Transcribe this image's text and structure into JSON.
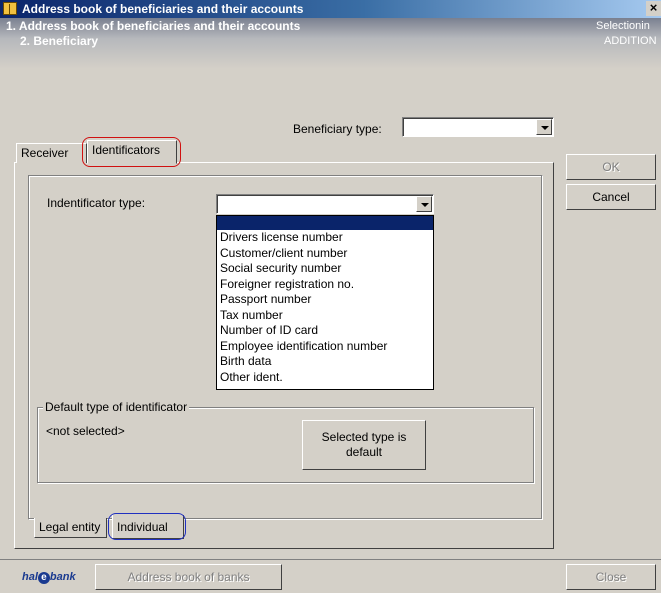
{
  "window": {
    "title": "Address book of beneficiaries and their accounts",
    "close_glyph": "×"
  },
  "header": {
    "line1": "1. Address book of beneficiaries and their accounts",
    "line2": "2. Beneficiary",
    "right1": "Selectionin",
    "right2": "ADDITION"
  },
  "beneficiary_type": {
    "label": "Beneficiary type:",
    "value": ""
  },
  "top_tabs": [
    {
      "label": "Receiver",
      "active": false
    },
    {
      "label": "Identificators",
      "active": true
    }
  ],
  "buttons": {
    "ok": "OK",
    "cancel": "Cancel",
    "selected_default": "Selected type is default"
  },
  "identificator_type": {
    "label": "Indentificator type:",
    "value": "",
    "options": [
      "",
      "Drivers license number",
      "Customer/client number",
      "Social security number",
      "Foreigner registration no.",
      "Passport number",
      "Tax number",
      "Number of ID card",
      "Employee identification number",
      "Birth data",
      "Other ident."
    ],
    "selected_index": 0
  },
  "default_group": {
    "legend": "Default type of identificator",
    "value": "<not selected>"
  },
  "bottom_tabs": [
    {
      "label": "Legal entity",
      "active": false
    },
    {
      "label": "Individual",
      "active": true
    }
  ],
  "status_bar": {
    "logo_prefix": "hal",
    "logo_e": "e",
    "logo_suffix": "bank",
    "address_book_banks": "Address book of banks",
    "close": "Close"
  },
  "colors": {
    "title_bar": "#0a246a",
    "selection": "#0a246a",
    "highlight_red": "#d01010",
    "highlight_blue": "#2030c0"
  }
}
